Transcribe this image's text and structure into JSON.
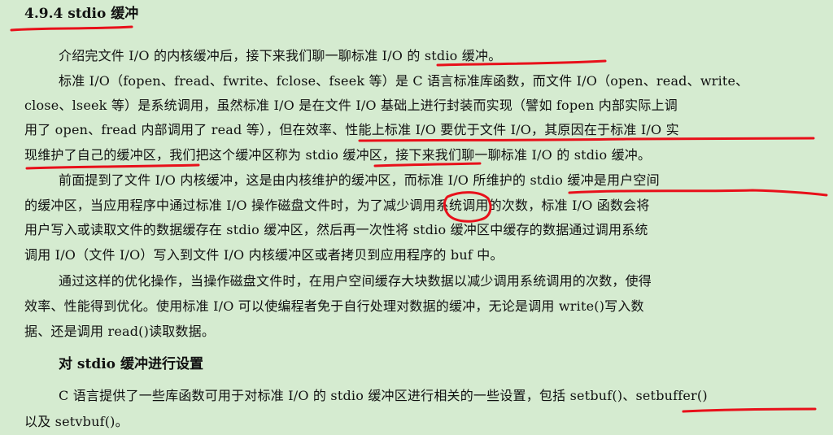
{
  "section": {
    "title": "4.9.4 stdio 缓冲"
  },
  "paragraphs": [
    {
      "lines": [
        "介绍完文件 I/O 的内核缓冲后，接下来我们聊一聊标准 I/O 的 stdio 缓冲。"
      ]
    },
    {
      "lines": [
        "标准 I/O（fopen、fread、fwrite、fclose、fseek 等）是 C 语言标准库函数，而文件 I/O（open、read、write、",
        "close、lseek 等）是系统调用，虽然标准 I/O 是在文件 I/O 基础上进行封装而实现（譬如 fopen 内部实际上调",
        "用了 open、fread 内部调用了 read 等），但在效率、性能上标准 I/O 要优于文件 I/O，其原因在于标准 I/O 实",
        "现维护了自己的缓冲区，我们把这个缓冲区称为 stdio 缓冲区，接下来我们聊一聊标准 I/O 的 stdio 缓冲。"
      ]
    },
    {
      "lines": [
        "前面提到了文件 I/O 内核缓冲，这是由内核维护的缓冲区，而标准 I/O 所维护的 stdio 缓冲是用户空间",
        "的缓冲区，当应用程序中通过标准 I/O 操作磁盘文件时，为了减少调用系统调用的次数，标准 I/O 函数会将",
        "用户写入或读取文件的数据缓存在 stdio 缓冲区，然后再一次性将 stdio 缓冲区中缓存的数据通过调用系统",
        "调用 I/O（文件 I/O）写入到文件 I/O 内核缓冲区或者拷贝到应用程序的 buf 中。"
      ]
    },
    {
      "lines": [
        "通过这样的优化操作，当操作磁盘文件时，在用户空间缓存大块数据以减少调用系统调用的次数，使得",
        "效率、性能得到优化。使用标准 I/O 可以使编程者免于自行处理对数据的缓冲，无论是调用 write()写入数",
        "据、还是调用 read()读取数据。"
      ]
    }
  ],
  "subsection": {
    "title": "对 stdio 缓冲进行设置"
  },
  "final_paragraph": {
    "lines": [
      "C 语言提供了一些库函数可用于对标准 I/O 的 stdio 缓冲区进行相关的一些设置，包括 setbuf()、setbuffer()",
      "以及 setvbuf()。"
    ]
  },
  "annotation_color": "#e8101a"
}
